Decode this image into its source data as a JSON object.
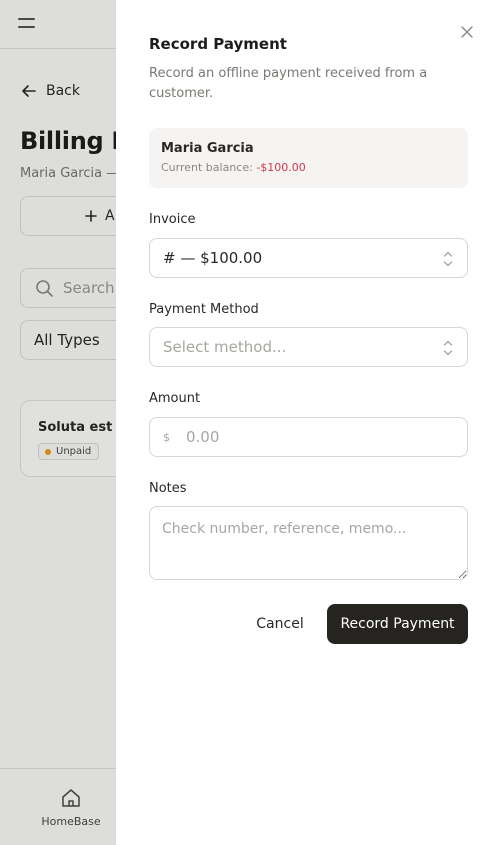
{
  "background": {
    "back_label": "Back",
    "title": "Billing Hi",
    "subtitle": "Maria Garcia —",
    "add_button_label": "A",
    "search_placeholder": "Search",
    "type_filter_value": "All Types",
    "card": {
      "title": "Soluta est ve",
      "badge": "Unpaid"
    },
    "bottom_nav": {
      "home_label": "HomeBase"
    }
  },
  "drawer": {
    "title": "Record Payment",
    "description": "Record an offline payment received from a customer.",
    "customer": {
      "name": "Maria Garcia",
      "balance_label": "Current balance: ",
      "balance_value": "-$100.00"
    },
    "invoice": {
      "label": "Invoice",
      "value": "# — $100.00"
    },
    "payment_method": {
      "label": "Payment Method",
      "placeholder": "Select method..."
    },
    "amount": {
      "label": "Amount",
      "currency": "$",
      "placeholder": "0.00"
    },
    "notes": {
      "label": "Notes",
      "placeholder": "Check number, reference, memo..."
    },
    "cancel_label": "Cancel",
    "submit_label": "Record Payment"
  },
  "colors": {
    "primary_button": "#262421",
    "negative": "#d0384a",
    "unpaid_dot": "#e79a1b"
  }
}
